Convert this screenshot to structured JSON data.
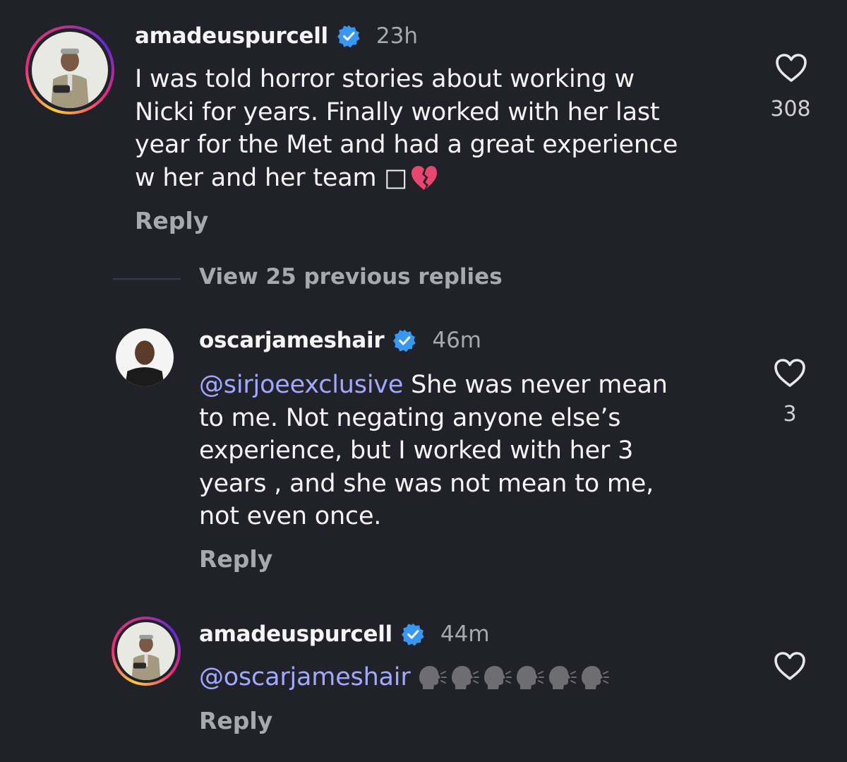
{
  "comments": [
    {
      "username": "amadeuspurcell",
      "time": "23h",
      "text_lines": [
        "I was told horror stories about working w",
        "Nicki for years. Finally worked with her last",
        "year for the Met and had a great experience",
        "w her and her team □"
      ],
      "likes": "308",
      "reply_label": "Reply"
    },
    {
      "username": "oscarjameshair",
      "time": "46m",
      "mention": "@sirjoeexclusive",
      "text_first": " She was never mean",
      "text_lines": [
        "to me. Not negating anyone else’s",
        "experience, but I worked with her 3",
        "years , and she was not mean to me,",
        "not even once."
      ],
      "likes": "3",
      "reply_label": "Reply"
    },
    {
      "username": "amadeuspurcell",
      "time": "44m",
      "mention": "@oscarjameshair",
      "reply_label": "Reply"
    }
  ],
  "view_previous": "View 25 previous replies",
  "colors": {
    "background": "#212129",
    "mention": "#a1a9ff",
    "verified": "#3897f0",
    "muted": "#a8a8b0"
  }
}
